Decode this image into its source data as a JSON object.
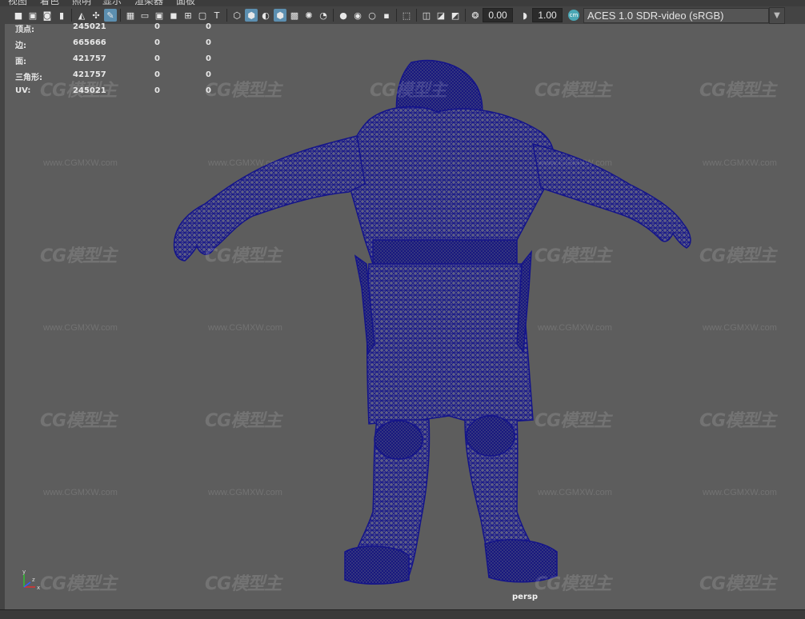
{
  "menu": {
    "items": [
      "视图",
      "着色",
      "照明",
      "显示",
      "渲染器",
      "面板"
    ]
  },
  "toolbar": {
    "exposure_value": "0.00",
    "gamma_value": "1.00",
    "color_management": "ACES 1.0 SDR-video (sRGB)",
    "icons": [
      "camera-icon",
      "camera-attributes-icon",
      "bookmark-icon",
      "image-plane-icon",
      "grid-icon",
      "film-gate-icon",
      "resolution-gate-icon",
      "gate-mask-icon",
      "field-chart-icon",
      "safe-action-icon",
      "safe-title-icon",
      "wireframe-icon",
      "smooth-shade-icon",
      "wireframe-on-shaded-icon",
      "textured-icon",
      "lights-icon",
      "shadows-icon",
      "ambient-occlusion-icon",
      "motion-blur-icon",
      "antialiasing-icon",
      "isolate-select-icon",
      "xray-icon",
      "xray-joints-icon",
      "backface-culling-icon",
      "exposure-icon",
      "gamma-icon",
      "color-management-icon"
    ]
  },
  "hud": {
    "rows": [
      {
        "label": "顶点:",
        "v1": "245021",
        "v2": "0",
        "v3": "0"
      },
      {
        "label": "边:",
        "v1": "665666",
        "v2": "0",
        "v3": "0"
      },
      {
        "label": "面:",
        "v1": "421757",
        "v2": "0",
        "v3": "0"
      },
      {
        "label": "三角形:",
        "v1": "421757",
        "v2": "0",
        "v3": "0"
      },
      {
        "label": "UV:",
        "v1": "245021",
        "v2": "0",
        "v3": "0"
      }
    ]
  },
  "viewport": {
    "camera": "persp",
    "watermark_logo": "CG模型主",
    "watermark_url": "www.CGMXW.com",
    "axis_labels": {
      "y": "y",
      "x": "x",
      "z": "z"
    },
    "mesh_color": "#1a1a8c",
    "background_color": "#5d5d5d"
  },
  "colors": {
    "active_icon": "#5c8fb0",
    "axis_x": "#e03030",
    "axis_y": "#30c030",
    "axis_z": "#3060ff"
  }
}
